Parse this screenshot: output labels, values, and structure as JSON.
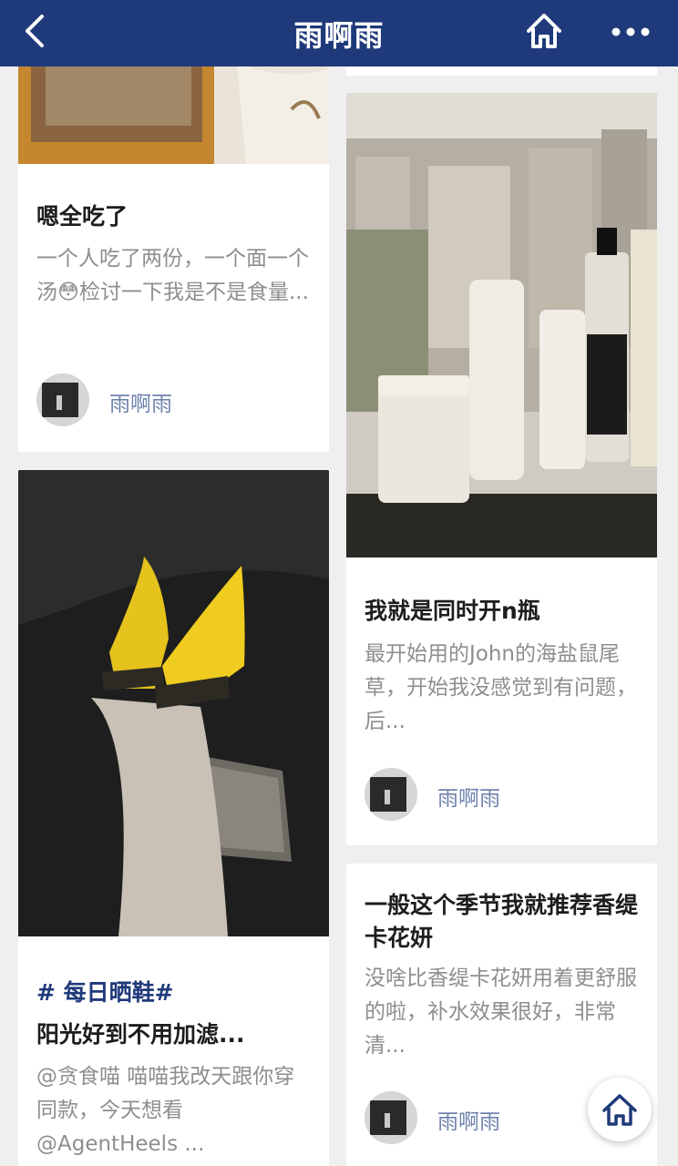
{
  "nav": {
    "title": "雨啊雨",
    "back_icon": "chevron-left-icon",
    "home_icon": "home-icon",
    "more_icon": "more-dots-icon",
    "bg_color": "#1f3a7a"
  },
  "posts": [
    {
      "title": "嗯全吃了",
      "desc": "一个人吃了两份，一个面一个汤😳检讨一下我是不是食量...",
      "author": "雨啊雨"
    },
    {
      "tag": "# 每日晒鞋#",
      "title": "阳光好到不用加滤...",
      "desc": "@贪食喵 喵喵我改天跟你穿同款，今天想看@AgentHeels ...",
      "author": ""
    },
    {
      "title": "我就是同时开n瓶",
      "desc": "最开始用的John的海盐鼠尾草，开始我没感觉到有问题，后...",
      "author": "雨啊雨"
    },
    {
      "title": "一般这个季节我就推荐香缇卡花妍",
      "desc": "没啥比香缇卡花妍用着更舒服的啦，补水效果很好，非常清...",
      "author": "雨啊雨"
    }
  ],
  "floating": {
    "icon": "home-icon"
  },
  "colors": {
    "accent": "#1f3a7a",
    "author": "#6f83ad",
    "muted_text": "#8e8e8e"
  }
}
